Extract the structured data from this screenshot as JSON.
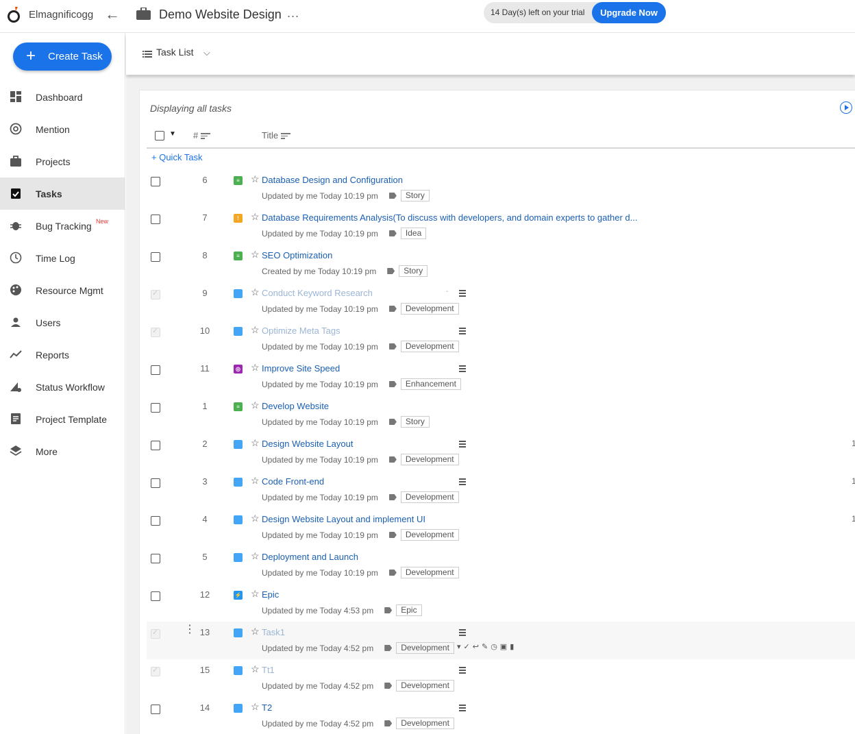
{
  "brand": {
    "name": "Elmagnificogg"
  },
  "project": {
    "title": "Demo Website Design",
    "more": "..."
  },
  "trial": {
    "text": "14 Day(s) left on your trial",
    "upgrade": "Upgrade Now"
  },
  "sidebar": {
    "create_label": "Create Task",
    "items": [
      {
        "label": "Dashboard",
        "icon": "dashboard-icon"
      },
      {
        "label": "Mention",
        "icon": "at-icon"
      },
      {
        "label": "Projects",
        "icon": "briefcase-icon"
      },
      {
        "label": "Tasks",
        "icon": "clipboard-check-icon",
        "active": true
      },
      {
        "label": "Bug Tracking",
        "icon": "bug-icon",
        "badge": "New"
      },
      {
        "label": "Time Log",
        "icon": "clock-icon"
      },
      {
        "label": "Resource Mgmt",
        "icon": "palette-icon"
      },
      {
        "label": "Users",
        "icon": "user-icon"
      },
      {
        "label": "Reports",
        "icon": "trend-icon"
      },
      {
        "label": "Status Workflow",
        "icon": "workflow-icon"
      },
      {
        "label": "Project Template",
        "icon": "document-icon"
      },
      {
        "label": "More",
        "icon": "layers-icon"
      }
    ]
  },
  "view": {
    "label": "Task List"
  },
  "list": {
    "display_label": "Displaying all tasks",
    "col_num": "#",
    "col_title": "Title",
    "quick_task": "Quick Task",
    "rows": [
      {
        "num": "6",
        "type": "story",
        "title": "Database Design and Configuration",
        "meta": "Updated by me Today 10:19 pm",
        "tag": "Story"
      },
      {
        "num": "7",
        "type": "idea",
        "title": "Database Requirements Analysis(To discuss with developers, and domain experts to gather d...",
        "meta": "Updated by me Today 10:19 pm",
        "tag": "Idea"
      },
      {
        "num": "8",
        "type": "story",
        "title": "SEO Optimization",
        "meta": "Created by me Today 10:19 pm",
        "tag": "Story"
      },
      {
        "num": "9",
        "type": "development",
        "title": "Conduct Keyword Research",
        "meta": "Updated by me Today 10:19 pm",
        "tag": "Development",
        "done": true,
        "subtasks": true,
        "dash": "-"
      },
      {
        "num": "10",
        "type": "development",
        "title": "Optimize Meta Tags",
        "meta": "Updated by me Today 10:19 pm",
        "tag": "Development",
        "done": true,
        "subtasks": true
      },
      {
        "num": "11",
        "type": "enhancement",
        "title": "Improve Site Speed",
        "meta": "Updated by me Today 10:19 pm",
        "tag": "Enhancement",
        "subtasks": true
      },
      {
        "num": "1",
        "type": "story",
        "title": "Develop Website",
        "meta": "Updated by me Today 10:19 pm",
        "tag": "Story"
      },
      {
        "num": "2",
        "type": "development",
        "title": "Design Website Layout",
        "meta": "Updated by me Today 10:19 pm",
        "tag": "Development",
        "subtasks": true,
        "right": "1"
      },
      {
        "num": "3",
        "type": "development",
        "title": "Code Front-end",
        "meta": "Updated by me Today 10:19 pm",
        "tag": "Development",
        "subtasks": true,
        "right": "1"
      },
      {
        "num": "4",
        "type": "development",
        "title": "Design Website Layout and implement UI",
        "meta": "Updated by me Today 10:19 pm",
        "tag": "Development",
        "right": "1"
      },
      {
        "num": "5",
        "type": "development",
        "title": "Deployment and Launch",
        "meta": "Updated by me Today 10:19 pm",
        "tag": "Development"
      },
      {
        "num": "12",
        "type": "epic",
        "title": "Epic",
        "meta": "Updated by me Today 4:53 pm",
        "tag": "Epic"
      },
      {
        "num": "13",
        "type": "development",
        "title": "Task1",
        "meta": "Updated by me Today 4:52 pm",
        "tag": "Development",
        "done": true,
        "subtasks": true,
        "hover": true
      },
      {
        "num": "15",
        "type": "development",
        "title": "Tt1",
        "meta": "Updated by me Today 4:52 pm",
        "tag": "Development",
        "done": true,
        "subtasks": true
      },
      {
        "num": "14",
        "type": "development",
        "title": "T2",
        "meta": "Updated by me Today 4:52 pm",
        "tag": "Development",
        "subtasks": true
      }
    ]
  },
  "colors": {
    "accent": "#1a73e8",
    "story": "#4caf50",
    "idea": "#f5a623",
    "development": "#42a5f5",
    "enhancement": "#9c27b0",
    "epic": "#2196f3"
  }
}
